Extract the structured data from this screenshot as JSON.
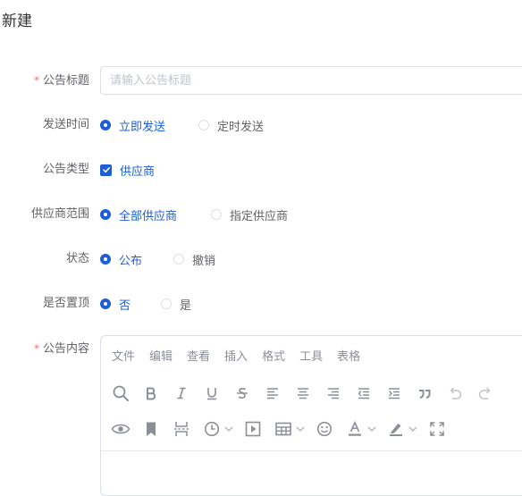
{
  "page": {
    "title": "新建"
  },
  "form": {
    "title_field": {
      "label": "公告标题",
      "required_mark": "*",
      "placeholder": "请输入公告标题",
      "value": ""
    },
    "send_time": {
      "label": "发送时间",
      "options": [
        "立即发送",
        "定时发送"
      ],
      "selected": "立即发送"
    },
    "notice_type": {
      "label": "公告类型",
      "checkbox_label": "供应商",
      "checked": true
    },
    "supplier_scope": {
      "label": "供应商范围",
      "options": [
        "全部供应商",
        "指定供应商"
      ],
      "selected": "全部供应商"
    },
    "status": {
      "label": "状态",
      "options": [
        "公布",
        "撤销"
      ],
      "selected": "公布"
    },
    "pinned": {
      "label": "是否置顶",
      "options": [
        "否",
        "是"
      ],
      "selected": "否"
    },
    "content": {
      "label": "公告内容",
      "required_mark": "*"
    }
  },
  "editor": {
    "menu": [
      "文件",
      "编辑",
      "查看",
      "插入",
      "格式",
      "工具",
      "表格"
    ],
    "toolbar_row1": [
      "search-icon",
      "bold-icon",
      "italic-icon",
      "underline-icon",
      "strikethrough-icon",
      "align-left-icon",
      "align-center-icon",
      "align-right-icon",
      "outdent-icon",
      "indent-icon",
      "blockquote-icon",
      "undo-icon",
      "redo-icon"
    ],
    "toolbar_row2": [
      "preview-icon",
      "bookmark-icon",
      "page-break-icon",
      "clock-icon",
      "media-icon",
      "table-icon",
      "emoji-icon",
      "font-color-icon",
      "highlight-icon",
      "fullscreen-icon"
    ]
  },
  "colors": {
    "primary": "#1d5ed6",
    "required": "#f56c6c",
    "label": "#606266",
    "icon": "#8a8f98"
  }
}
